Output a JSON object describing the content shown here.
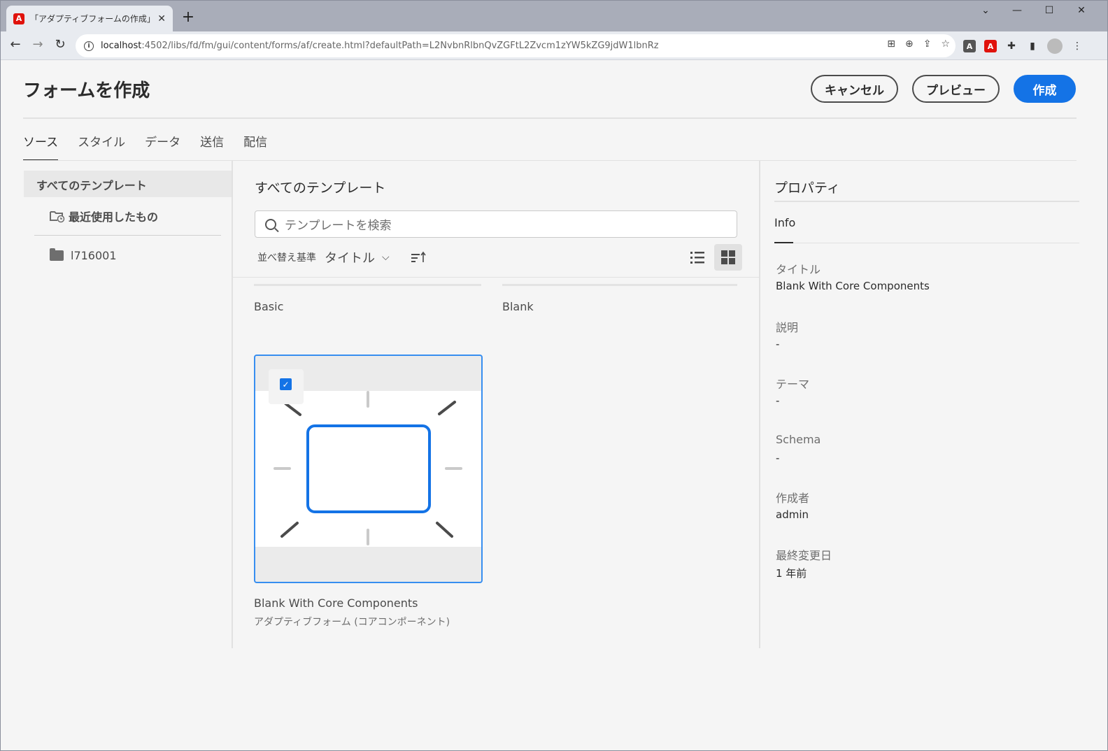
{
  "browser": {
    "tab_title": "「アダプティブフォームの作成」から設定",
    "tab_close": "✕",
    "new_tab": "+",
    "url_host": "localhost",
    "url_path": ":4502/libs/fd/fm/gui/content/forms/af/create.html?defaultPath=L2NvbnRlbnQvZGFtL2Zvcm1zYW5kZG9jdW1lbnRz"
  },
  "header": {
    "title": "フォームを作成",
    "cancel_label": "キャンセル",
    "preview_label": "プレビュー",
    "create_label": "作成"
  },
  "tabs": [
    {
      "label": "ソース",
      "active": true
    },
    {
      "label": "スタイル"
    },
    {
      "label": "データ"
    },
    {
      "label": "送信"
    },
    {
      "label": "配信"
    }
  ],
  "rail": {
    "selected": "すべてのテンプレート",
    "recent": "最近使用したもの",
    "folder": "l716001"
  },
  "center": {
    "title": "すべてのテンプレート",
    "search_placeholder": "テンプレートを検索",
    "sort_label": "並べ替え基準",
    "sort_value": "タイトル",
    "cards": [
      {
        "name": "Basic"
      },
      {
        "name": "Blank"
      },
      {
        "name": "Blank With Core Components",
        "subtitle": "アダプティブフォーム (コアコンポーネント)",
        "selected": true
      }
    ]
  },
  "properties": {
    "title": "プロパティ",
    "tab": "Info",
    "fields": [
      {
        "label": "タイトル",
        "value": "Blank With Core Components"
      },
      {
        "label": "説明",
        "value": "-"
      },
      {
        "label": "テーマ",
        "value": "-"
      },
      {
        "label": "Schema",
        "value": "-"
      },
      {
        "label": "作成者",
        "value": "admin"
      },
      {
        "label": "最終変更日",
        "value": "1 年前"
      }
    ]
  },
  "colors": {
    "accent": "#1473e6",
    "selection_border": "#378ef0"
  }
}
